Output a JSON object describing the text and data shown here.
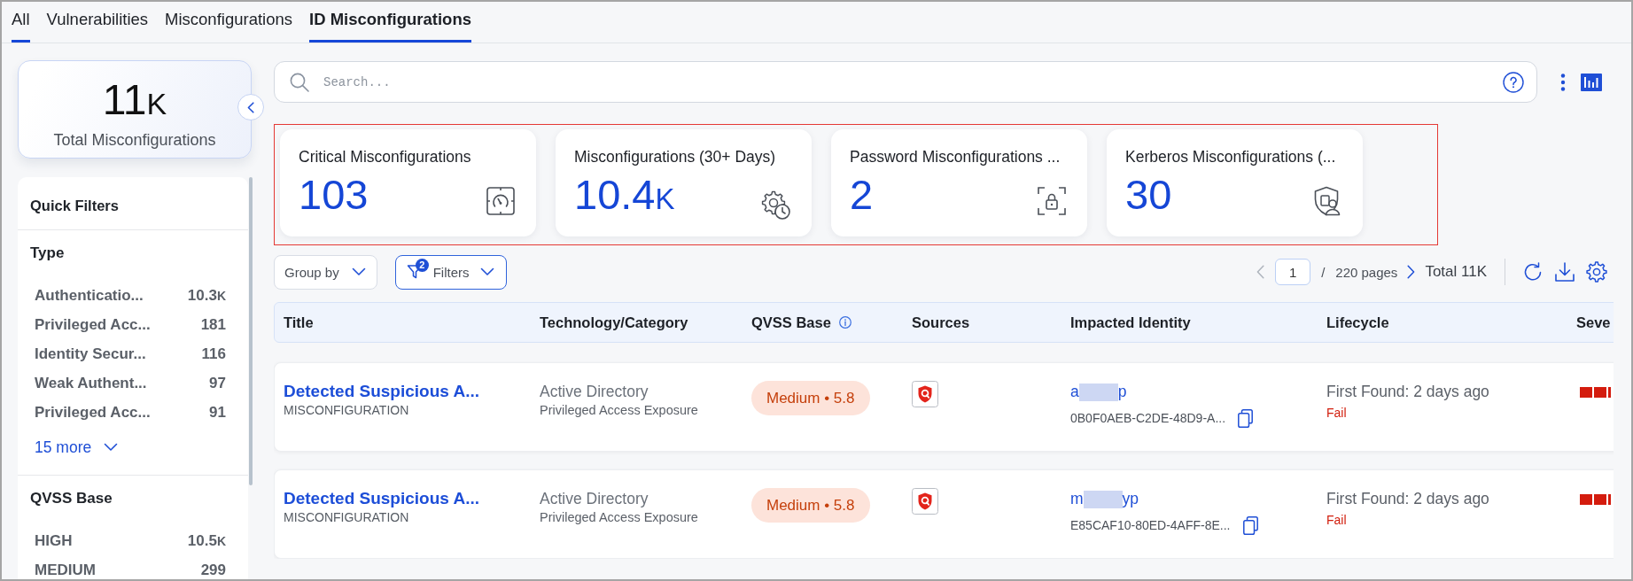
{
  "tabs": [
    {
      "label": "All",
      "selected": false,
      "underlined": true
    },
    {
      "label": "Vulnerabilities",
      "selected": false,
      "underlined": false
    },
    {
      "label": "Misconfigurations",
      "selected": false,
      "underlined": false
    },
    {
      "label": "ID Misconfigurations",
      "selected": true,
      "underlined": true
    }
  ],
  "total": {
    "value": "11",
    "unit": "K",
    "label": "Total Misconfigurations"
  },
  "quick_filters": {
    "title": "Quick Filters",
    "sections": [
      {
        "title": "Type",
        "items": [
          {
            "label": "Authenticatio...",
            "count": "10.3",
            "unit": "K"
          },
          {
            "label": "Privileged Acc...",
            "count": "181"
          },
          {
            "label": "Identity Secur...",
            "count": "116"
          },
          {
            "label": "Weak Authent...",
            "count": "97"
          },
          {
            "label": "Privileged Acc...",
            "count": "91"
          }
        ],
        "more": "15 more"
      },
      {
        "title": "QVSS Base",
        "items": [
          {
            "label": "HIGH",
            "count": "10.5",
            "unit": "K"
          },
          {
            "label": "MEDIUM",
            "count": "299"
          }
        ]
      }
    ]
  },
  "search": {
    "placeholder": "Search..."
  },
  "summary_cards": [
    {
      "title": "Critical Misconfigurations",
      "value": "103"
    },
    {
      "title": "Misconfigurations (30+ Days)",
      "value": "10.4",
      "unit": "K"
    },
    {
      "title": "Password Misconfigurations ...",
      "value": "2"
    },
    {
      "title": "Kerberos Misconfigurations (...",
      "value": "30"
    }
  ],
  "toolbar": {
    "group_by": "Group by",
    "filters": {
      "label": "Filters",
      "count": "2"
    }
  },
  "pagination": {
    "page": "1",
    "separator": "/",
    "pages": "220 pages",
    "total": "Total 11K"
  },
  "table": {
    "columns": [
      {
        "label": "Title",
        "info": false
      },
      {
        "label": "Technology/Category",
        "info": false
      },
      {
        "label": "QVSS Base",
        "info": true
      },
      {
        "label": "Sources",
        "info": false
      },
      {
        "label": "Impacted Identity",
        "info": false
      },
      {
        "label": "Lifecycle",
        "info": false
      },
      {
        "label": "Seve",
        "info": false
      }
    ],
    "rows": [
      {
        "title": "Detected Suspicious A...",
        "type": "MISCONFIGURATION",
        "technology": "Active Directory",
        "category": "Privileged Access Exposure",
        "qvss": "Medium • 5.8",
        "identity": {
          "name_start": "a",
          "name_end": "p",
          "redacted": true,
          "id": "0B0F0AEB-C2DE-48D9-A..."
        },
        "first_found": "First Found: 2 days ago",
        "status": "Fail"
      },
      {
        "title": "Detected Suspicious A...",
        "type": "MISCONFIGURATION",
        "technology": "Active Directory",
        "category": "Privileged Access Exposure",
        "qvss": "Medium • 5.8",
        "identity": {
          "name_start": "m",
          "name_end": "yp",
          "redacted": true,
          "id": "E85CAF10-80ED-4AFF-8E..."
        },
        "first_found": "First Found: 2 days ago",
        "status": "Fail"
      }
    ]
  }
}
